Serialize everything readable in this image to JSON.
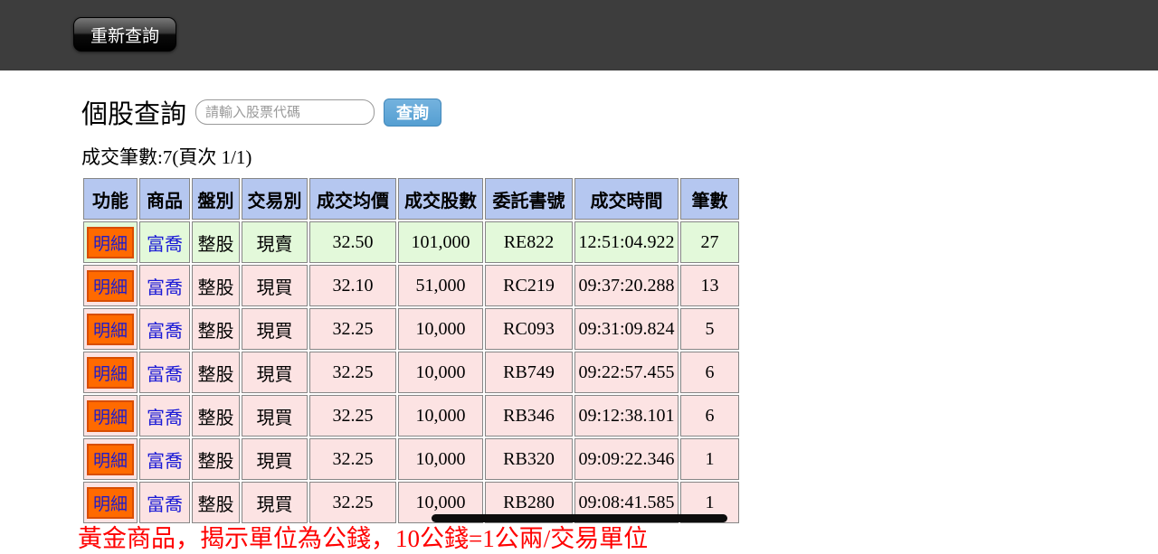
{
  "header": {
    "requery_label": "重新查詢"
  },
  "query": {
    "title": "個股查詢",
    "input_placeholder": "請輸入股票代碼",
    "input_value": "",
    "search_label": "查詢"
  },
  "summary": "成交筆數:7(頁次 1/1)",
  "table": {
    "columns": [
      "功能",
      "商品",
      "盤別",
      "交易別",
      "成交均價",
      "成交股數",
      "委託書號",
      "成交時間",
      "筆數"
    ],
    "row_keys": [
      "action",
      "product",
      "market",
      "trade_type",
      "avg_price",
      "shares",
      "order_no",
      "time",
      "count"
    ],
    "rows": [
      {
        "action": "明細",
        "product": "富喬",
        "market": "整股",
        "trade_type": "現賣",
        "avg_price": "32.50",
        "shares": "101,000",
        "order_no": "RE822",
        "time": "12:51:04.922",
        "count": "27",
        "tone": "green"
      },
      {
        "action": "明細",
        "product": "富喬",
        "market": "整股",
        "trade_type": "現買",
        "avg_price": "32.10",
        "shares": "51,000",
        "order_no": "RC219",
        "time": "09:37:20.288",
        "count": "13",
        "tone": "pink"
      },
      {
        "action": "明細",
        "product": "富喬",
        "market": "整股",
        "trade_type": "現買",
        "avg_price": "32.25",
        "shares": "10,000",
        "order_no": "RC093",
        "time": "09:31:09.824",
        "count": "5",
        "tone": "pink"
      },
      {
        "action": "明細",
        "product": "富喬",
        "market": "整股",
        "trade_type": "現買",
        "avg_price": "32.25",
        "shares": "10,000",
        "order_no": "RB749",
        "time": "09:22:57.455",
        "count": "6",
        "tone": "pink"
      },
      {
        "action": "明細",
        "product": "富喬",
        "market": "整股",
        "trade_type": "現買",
        "avg_price": "32.25",
        "shares": "10,000",
        "order_no": "RB346",
        "time": "09:12:38.101",
        "count": "6",
        "tone": "pink"
      },
      {
        "action": "明細",
        "product": "富喬",
        "market": "整股",
        "trade_type": "現買",
        "avg_price": "32.25",
        "shares": "10,000",
        "order_no": "RB320",
        "time": "09:09:22.346",
        "count": "1",
        "tone": "pink"
      },
      {
        "action": "明細",
        "product": "富喬",
        "market": "整股",
        "trade_type": "現買",
        "avg_price": "32.25",
        "shares": "10,000",
        "order_no": "RB280",
        "time": "09:08:41.585",
        "count": "1",
        "tone": "pink"
      }
    ]
  },
  "footer_note": "黃金商品，揭示單位為公錢，10公錢=1公兩/交易單位",
  "colors": {
    "topbar_bg": "#3d3d3d",
    "header_cell_bg": "#b5c7f0",
    "sell_row_bg": "#e3f9da",
    "buy_row_bg": "#fce3e3",
    "detail_button_bg": "#ff6a00",
    "detail_button_text": "#1c1ccd",
    "search_button_bg": "#559fd2",
    "link_text": "#1a1ad6",
    "footer_text": "#ff0000"
  }
}
